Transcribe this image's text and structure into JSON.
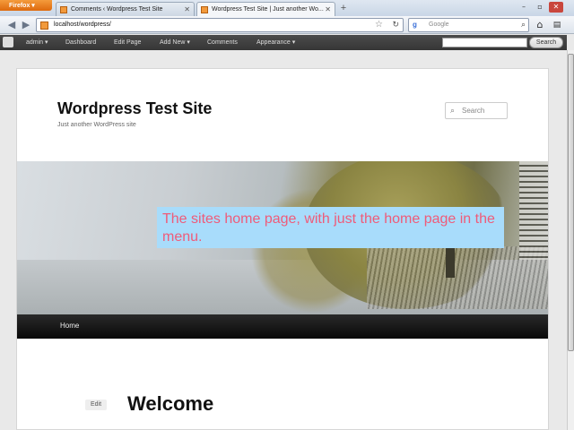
{
  "browser": {
    "menu_button": "Firefox",
    "tabs": [
      {
        "title": "Comments ‹ Wordpress Test Site",
        "active": false
      },
      {
        "title": "Wordpress Test Site | Just another Wo...",
        "active": true
      }
    ],
    "url": "localhost/wordpress/",
    "search_engine": "Google",
    "search_placeholder": "Google"
  },
  "admin_bar": {
    "items": [
      "admin",
      "Dashboard",
      "Edit Page",
      "Add New",
      "Comments",
      "Appearance"
    ],
    "search_button": "Search"
  },
  "site": {
    "title": "Wordpress Test Site",
    "tagline": "Just another WordPress site",
    "search_placeholder": "Search",
    "menu": [
      "Home"
    ],
    "edit_label": "Edit",
    "post_title": "Welcome"
  },
  "annotation": {
    "text": "The sites home page, with just the home page in the menu.",
    "bg_color": "#a8dcfb",
    "text_color": "#ef5b79"
  },
  "icons": {
    "back": "back-arrow-icon",
    "forward": "forward-arrow-icon",
    "bookmark": "star-icon",
    "reload": "reload-icon",
    "home": "home-icon"
  }
}
